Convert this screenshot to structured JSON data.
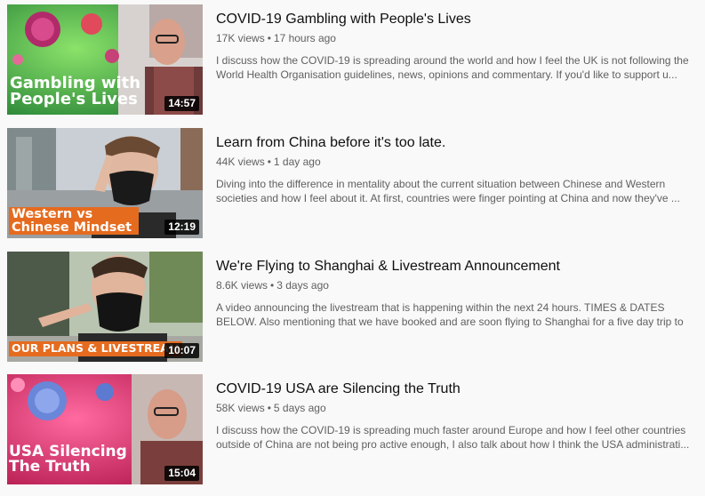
{
  "videos": [
    {
      "title": "COVID-19 Gambling with People's Lives",
      "views": "17K views",
      "age": "17 hours ago",
      "desc_line1": "I discuss how the COVID-19 is spreading around the world and how I feel the UK is not following the",
      "desc_line2": "World Health Organisation guidelines, news, opinions and commentary. If you'd like to support u...",
      "overlay": "Gambling with\nPeople's Lives",
      "duration": "14:57"
    },
    {
      "title": "Learn from China before it's too late.",
      "views": "44K views",
      "age": "1 day ago",
      "desc_line1": "Diving into the difference in mentality about the current situation between Chinese and Western",
      "desc_line2": "societies and how I feel about it. At first, countries were finger pointing at China and now they've ...",
      "overlay": "Western vs\nChinese Mindset",
      "duration": "12:19"
    },
    {
      "title": "We're Flying to Shanghai & Livestream Announcement",
      "views": "8.6K views",
      "age": "3 days ago",
      "desc_line1": "A video announcing the livestream that is happening within the next 24 hours. TIMES & DATES",
      "desc_line2": "BELOW. Also mentioning that we have booked and are soon flying to Shanghai for a five day trip to",
      "overlay": "OUR PLANS & LIVESTREAM",
      "duration": "10:07"
    },
    {
      "title": "COVID-19 USA are Silencing the Truth",
      "views": "58K views",
      "age": "5 days ago",
      "desc_line1": "I discuss how the COVID-19 is spreading much faster around Europe and how I feel other countries",
      "desc_line2": "outside of China are not being pro active enough, I also talk about how I think the USA administrati...",
      "overlay": "USA Silencing\nThe Truth",
      "duration": "15:04"
    }
  ]
}
